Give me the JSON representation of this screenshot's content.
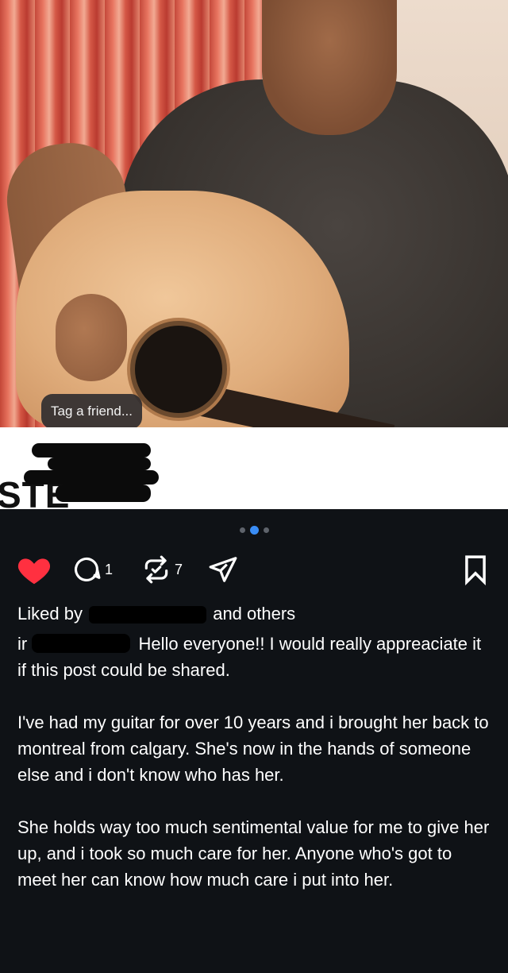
{
  "photo": {
    "tag_label": "Tag a friend..."
  },
  "banner": {
    "partial_text": "STE"
  },
  "carousel": {
    "dot_count": 3,
    "active_index": 1
  },
  "actions": {
    "comment_count": "1",
    "repost_count": "7",
    "like_color": "#ff3040"
  },
  "caption": {
    "likes_prefix": "Liked by",
    "likes_suffix": "and others",
    "username_fragment": "ir",
    "lead": "Hello everyone!! I would really appreaciate it if this post could be shared.",
    "paragraph2": "I've had my guitar for over 10 years and i brought her back to montreal from calgary. She's now in the hands of someone else and i don't know who has her.",
    "paragraph3": "She holds way too much sentimental value for me to give her up, and i took so much care for her. Anyone who's got to meet her can know how much care i put into her."
  }
}
